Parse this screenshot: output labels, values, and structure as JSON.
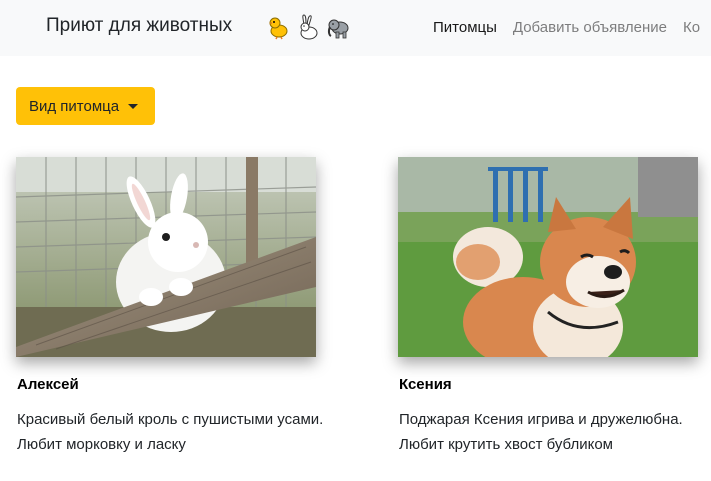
{
  "navbar": {
    "brand": "Приют для животных",
    "icons": [
      "chick-icon",
      "rabbit-icon",
      "elephant-icon"
    ],
    "links": [
      {
        "label": "Питомцы",
        "active": true
      },
      {
        "label": "Добавить объявление",
        "active": false
      },
      {
        "label": "Ко",
        "active": false
      }
    ]
  },
  "filter": {
    "dropdown_label": "Вид питомца"
  },
  "pets": [
    {
      "name": "Алексей",
      "description": "Красивый белый кроль с пушистыми усами. Любит морковку и ласку",
      "image": "white-rabbit-photo"
    },
    {
      "name": "Ксения",
      "description": "Поджарая Ксения игрива и дружелюбна. Любит крутить хвост бубликом",
      "image": "shiba-inu-dog-photo"
    }
  ],
  "colors": {
    "accent": "#ffc107",
    "navbar_bg": "#f8f9fa"
  }
}
